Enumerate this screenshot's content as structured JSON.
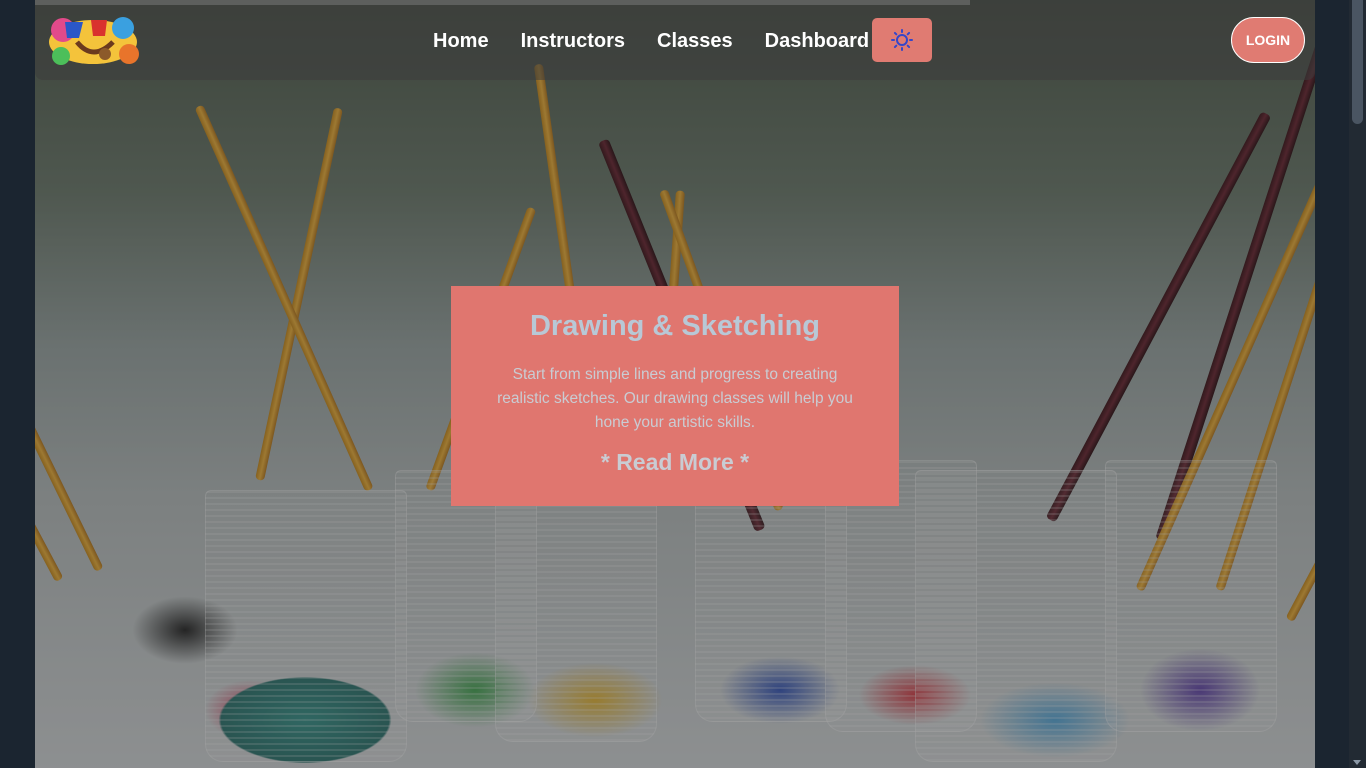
{
  "nav": {
    "logo_alt": "Art & Craft logo",
    "links": [
      {
        "label": "Home"
      },
      {
        "label": "Instructors"
      },
      {
        "label": "Classes"
      },
      {
        "label": "Dashboard"
      }
    ],
    "theme_toggle_icon": "sun-icon",
    "login_label": "LOGIN"
  },
  "hero": {
    "slide_title": "Drawing & Sketching",
    "slide_text": "Start from simple lines and progress to creating realistic sketches. Our drawing classes will help you hone your artistic skills.",
    "read_more": "* Read More *"
  },
  "colors": {
    "accent": "#e07b72",
    "background": "#1b2530"
  }
}
